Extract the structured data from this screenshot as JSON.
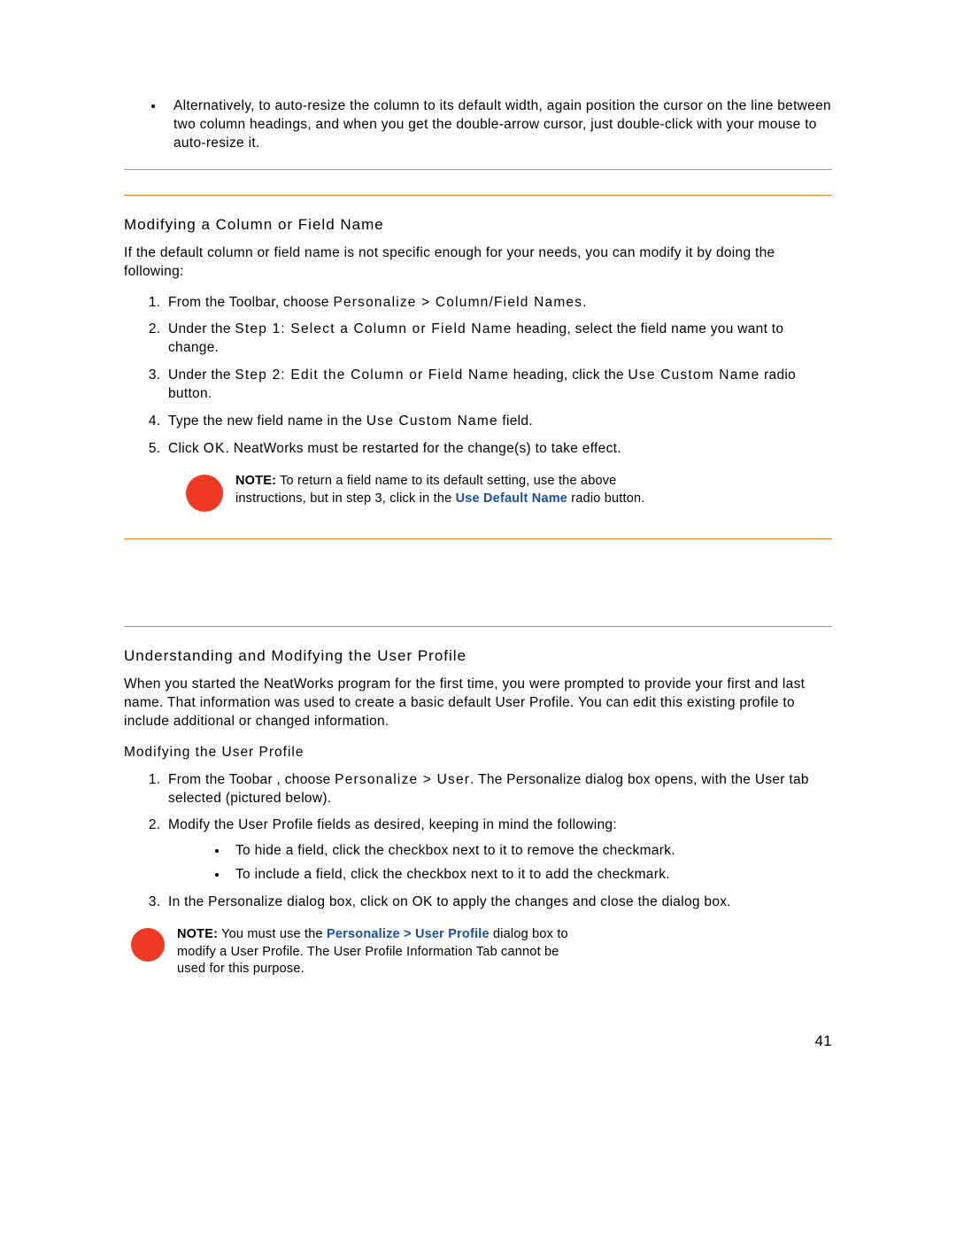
{
  "topBullet": "Alternatively, to auto-resize the column to its default width, again position the cursor on the line between two column headings, and when you get the double-arrow cursor, just double-click with your mouse to auto-resize it.",
  "section1": {
    "heading": "Modifying a Column or Field Name",
    "intro": "If the default column or field name is not specific enough for your needs, you can modify it by doing the following:",
    "step1_a": "From the Toolbar, choose ",
    "step1_b": "Personalize > Column/Field Names",
    "step1_c": ".",
    "step2_a": "Under the ",
    "step2_b": "Step 1: Select a Column or Field Name",
    "step2_c": " heading, select the field name you want to change.",
    "step3_a": "Under the ",
    "step3_b": "Step 2: Edit the Column or Field Name",
    "step3_c": " heading, click the ",
    "step3_d": "Use Custom Name",
    "step3_e": " radio button.",
    "step4_a": "Type the new field name in the ",
    "step4_b": "Use Custom Name",
    "step4_c": " field.",
    "step5_a": "Click ",
    "step5_b": "OK",
    "step5_c": ". NeatWorks must be restarted for the change(s) to take effect.",
    "note_label": "NOTE:",
    "note_a": " To return a field name to its default setting, use the above instructions, but in step 3, click in the ",
    "note_b": "Use Default Name",
    "note_c": " radio button."
  },
  "section2": {
    "heading": "Understanding and Modifying the User Profile",
    "intro": "When you started the NeatWorks program for the first time, you were prompted to provide your first and last name. That information was used to create a basic default User Profile. You can edit this existing profile to include additional or changed information.",
    "subhead": "Modifying the User Profile",
    "step1_a": "From the Toobar , choose ",
    "step1_b": "Personalize > User",
    "step1_c": ". The Personalize dialog box opens, with the User tab selected (pictured below).",
    "step2": "Modify the User Profile fields as desired, keeping in mind the following:",
    "step2_sub1": "To hide a field, click the checkbox next to it to remove the checkmark.",
    "step2_sub2": "To include a field, click the checkbox next to it to add the checkmark.",
    "step3": "In the Personalize dialog box, click on OK to apply the changes and close the dialog box.",
    "note_label": "NOTE:",
    "note_a": " You must use the ",
    "note_b": "Personalize > User Profile",
    "note_c": " dialog box to modify a User Profile. The User Profile Information Tab cannot be used for this purpose."
  },
  "pageNumber": "41"
}
